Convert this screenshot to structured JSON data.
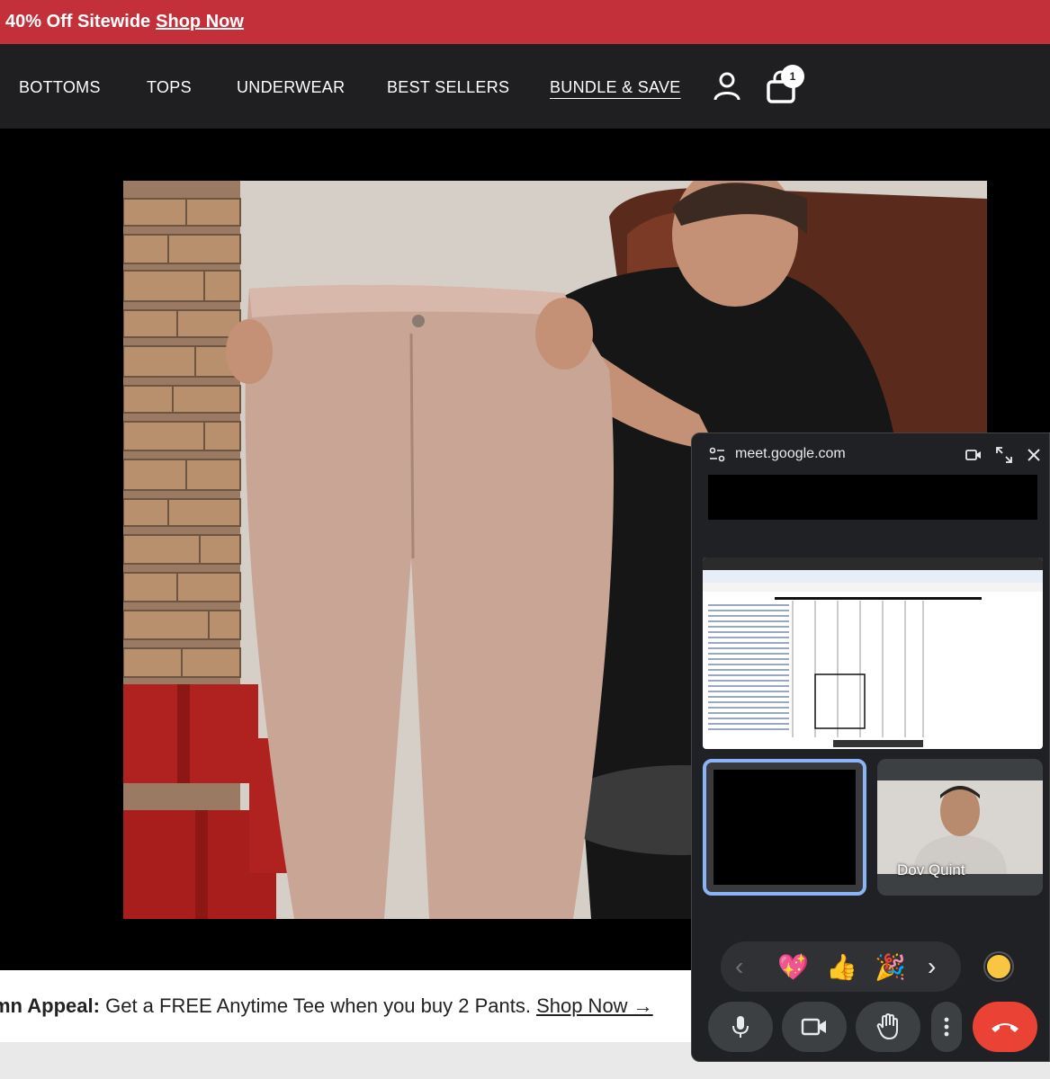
{
  "promo": {
    "text": "40% Off Sitewide",
    "link": "Shop Now"
  },
  "nav": {
    "items": [
      {
        "label": "BOTTOMS"
      },
      {
        "label": "TOPS"
      },
      {
        "label": "UNDERWEAR"
      },
      {
        "label": "BEST SELLERS"
      },
      {
        "label": "BUNDLE & SAVE"
      }
    ],
    "account_icon": "user-icon",
    "cart_icon": "shopping-bag-icon",
    "cart_count": "1"
  },
  "appeal": {
    "bold": "mn Appeal:",
    "text": " Get a FREE Anytime Tee when you buy 2 Pants. ",
    "link": "Shop Now →"
  },
  "meet": {
    "url": "meet.google.com",
    "participant_name": "Dov Quint",
    "reactions": [
      "💖",
      "👍",
      "🎉"
    ],
    "icons": [
      "site-settings-icon",
      "video-icon",
      "expand-icon",
      "close-icon",
      "microphone-icon",
      "camera-icon",
      "raise-hand-icon",
      "more-options-icon",
      "end-call-icon",
      "chevron-left-icon",
      "chevron-right-icon"
    ]
  },
  "colors": {
    "promo_bg": "#c4303a",
    "nav_bg": "#1f1f21",
    "meet_bg": "#202124",
    "end_call": "#ea4335",
    "active_tile": "#8ab4f8"
  }
}
